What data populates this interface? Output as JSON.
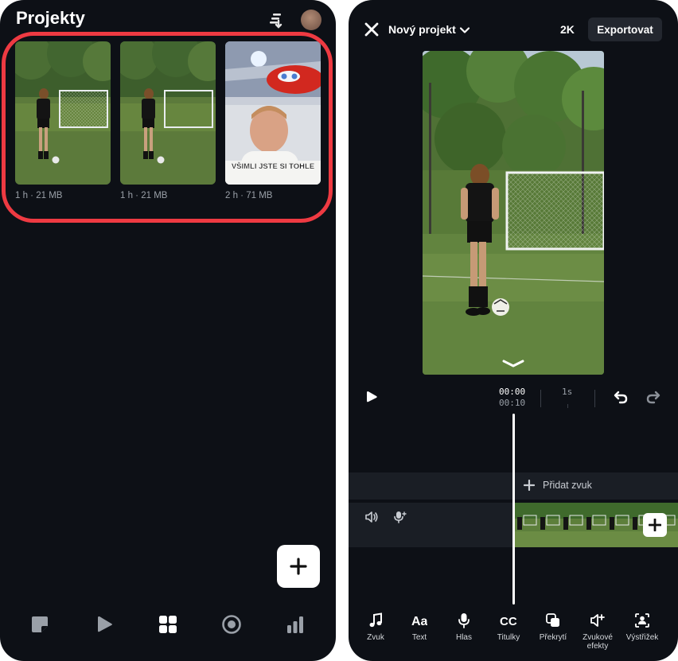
{
  "left": {
    "title": "Projekty",
    "projects": [
      {
        "meta": "1 h · 21 MB"
      },
      {
        "meta": "1 h · 21 MB"
      },
      {
        "meta": "2 h · 71 MB",
        "caption": "VŠIMLI JSTE SI TOHLE"
      }
    ],
    "icons": {
      "sort": "sort-icon",
      "add": "plus-icon"
    },
    "bottom_nav": [
      "sticker-icon",
      "play-icon",
      "grid-icon",
      "record-icon",
      "chart-icon"
    ],
    "accent_highlight": "#ee3a42"
  },
  "right": {
    "project_name": "Nový projekt",
    "resolution": "2K",
    "export_label": "Exportovat",
    "time_current": "00:00",
    "time_total": "00:10",
    "timeline_tick": "1s",
    "add_audio_label": "Přidat zvuk",
    "toolbar": [
      {
        "label": "Zvuk",
        "icon": "music-note-icon"
      },
      {
        "label": "Text",
        "icon": "text-icon"
      },
      {
        "label": "Hlas",
        "icon": "microphone-icon"
      },
      {
        "label": "Titulky",
        "icon": "captions-icon"
      },
      {
        "label": "Překrytí",
        "icon": "overlay-icon"
      },
      {
        "label": "Zvukové efekty",
        "icon": "sound-effects-icon"
      },
      {
        "label": "Výstřižek",
        "icon": "cutout-icon"
      }
    ]
  }
}
